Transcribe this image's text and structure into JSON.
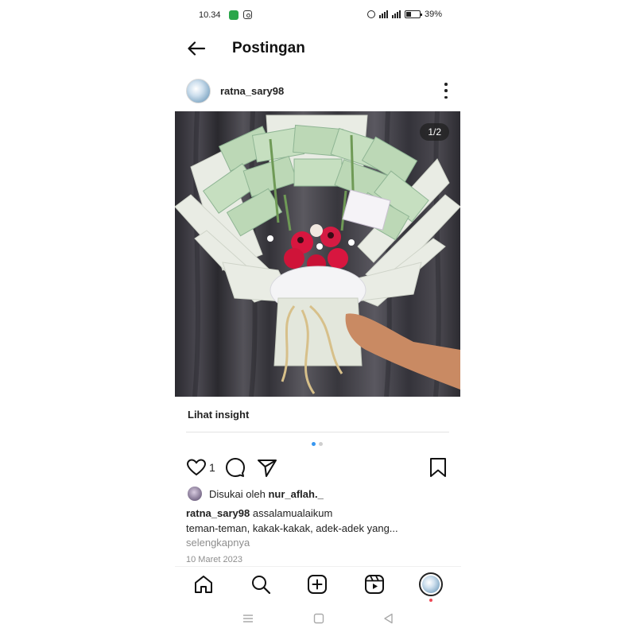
{
  "status_bar": {
    "time": "10.34",
    "battery_text": "39%",
    "battery_level": 0.39,
    "icons": [
      "app-badge-icon",
      "instagram-icon",
      "alarm-icon",
      "signal-4g-icon",
      "signal-icon",
      "battery-icon"
    ]
  },
  "header": {
    "title": "Postingan",
    "back_icon": "arrow-left-icon"
  },
  "post": {
    "username": "ratna_sary98",
    "more_icon": "more-vertical-icon",
    "image_counter": "1/2",
    "image_index": 1,
    "image_total": 2,
    "image_description": "money bouquet",
    "insight_label": "Lihat insight",
    "like_count": "1",
    "liked_by_prefix": "Disukai oleh",
    "liked_by_user": "nur_aflah._",
    "caption_user": "ratna_sary98",
    "caption_first": "assalamualaikum",
    "caption_second": "teman-teman, kakak-kakak, adek-adek yang...",
    "more_label": "selengkapnya",
    "date": "10 Maret 2023"
  },
  "colors": {
    "accent": "#3897f0",
    "notification": "#ed4956",
    "muted_text": "#8e8e8e"
  },
  "bottom_nav": [
    "home-icon",
    "search-icon",
    "create-icon",
    "reels-icon",
    "profile-avatar"
  ],
  "system_nav": [
    "menu-icon",
    "home-square-icon",
    "back-triangle-icon"
  ]
}
